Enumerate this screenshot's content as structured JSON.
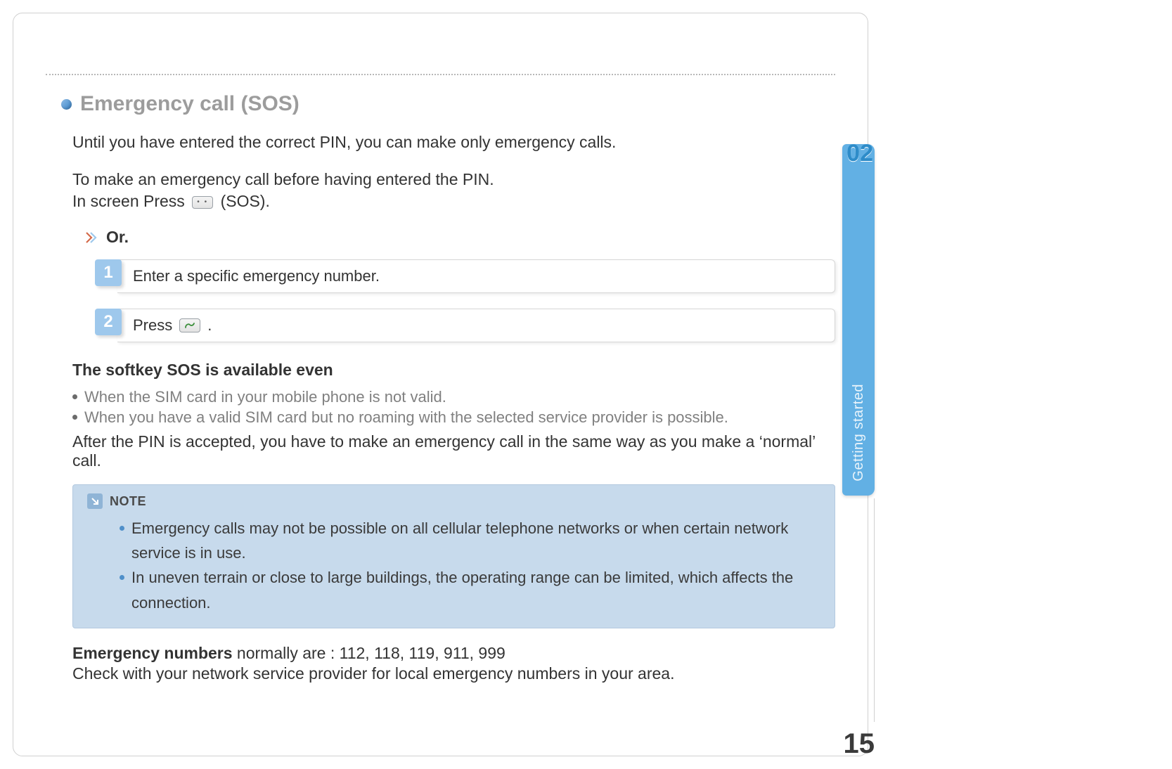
{
  "chapter": {
    "number": "02",
    "label": "Getting started"
  },
  "page_number": "15",
  "heading": "Emergency call (SOS)",
  "intro": "Until you have entered the correct PIN, you can make only emergency calls.",
  "instruction_line1": "To make an emergency call before having entered the PIN.",
  "instruction_line2_pre": "In screen Press ",
  "instruction_line2_post": " (SOS).",
  "or_label": "Or.",
  "steps": [
    {
      "num": "1",
      "text": "Enter a specific emergency number."
    },
    {
      "num": "2",
      "text_pre": "Press ",
      "text_post": "."
    }
  ],
  "sub_heading": "The softkey SOS is available even",
  "conditions": [
    "When the SIM card in your mobile phone is not valid.",
    "When you have a valid SIM card but no roaming with the selected service provider is possible."
  ],
  "after_pin": "After the PIN is accepted, you have to make an emergency call in the same way as you make a ‘normal’ call.",
  "note": {
    "label": "NOTE",
    "items": [
      "Emergency calls may not be possible on all cellular telephone networks or when certain network service is in use.",
      "In uneven terrain or close to large buildings, the operating range can be limited, which affects the connection."
    ]
  },
  "emergency_numbers_label": "Emergency numbers",
  "emergency_numbers_rest": " normally are : 112, 118, 119, 911, 999",
  "emergency_check": "Check with your network service provider for local emergency numbers in your area."
}
